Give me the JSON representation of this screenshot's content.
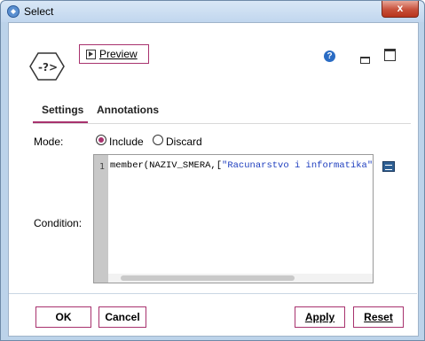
{
  "window": {
    "title": "Select",
    "close_label": "x"
  },
  "toolbar": {
    "preview_label": "Preview",
    "help_symbol": "?"
  },
  "tabs": [
    {
      "label": "Settings",
      "active": true
    },
    {
      "label": "Annotations",
      "active": false
    }
  ],
  "mode": {
    "label": "Mode:",
    "options": [
      {
        "label": "Include",
        "checked": true
      },
      {
        "label": "Discard",
        "checked": false
      }
    ]
  },
  "condition": {
    "label": "Condition:",
    "line_number": "1",
    "code_prefix": "member(NAZIV_SMERA,[",
    "code_string": "\"Racunarstvo i informatika\""
  },
  "buttons": {
    "ok": "OK",
    "cancel": "Cancel",
    "apply": "Apply",
    "reset": "Reset"
  },
  "colors": {
    "accent": "#a8326e",
    "titlebar": "#c1d6ee",
    "close": "#c7503a"
  },
  "icons": {
    "window": "select-node-icon",
    "node": "select-node-icon",
    "help": "help-icon",
    "expression_builder": "expression-builder-icon"
  }
}
